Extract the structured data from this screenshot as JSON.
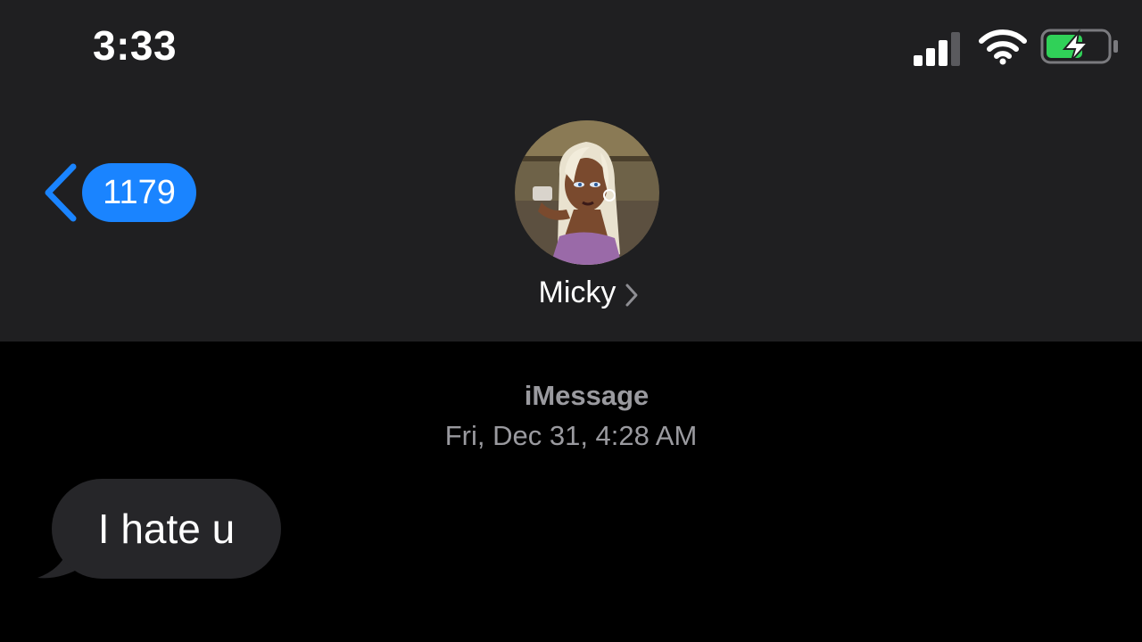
{
  "status_bar": {
    "time": "3:33",
    "icons": [
      "cellular-signal-icon",
      "wifi-icon",
      "battery-charging-icon"
    ],
    "battery_color": "#30d158"
  },
  "nav": {
    "back_badge_count": "1179",
    "accent_color": "#1a84ff",
    "contact_name": "Micky",
    "avatar": "contact-avatar-image"
  },
  "thread": {
    "service_label": "iMessage",
    "timestamp": "Fri, Dec 31, 4:28 AM",
    "messages": [
      {
        "direction": "incoming",
        "text": "I hate u"
      }
    ]
  }
}
